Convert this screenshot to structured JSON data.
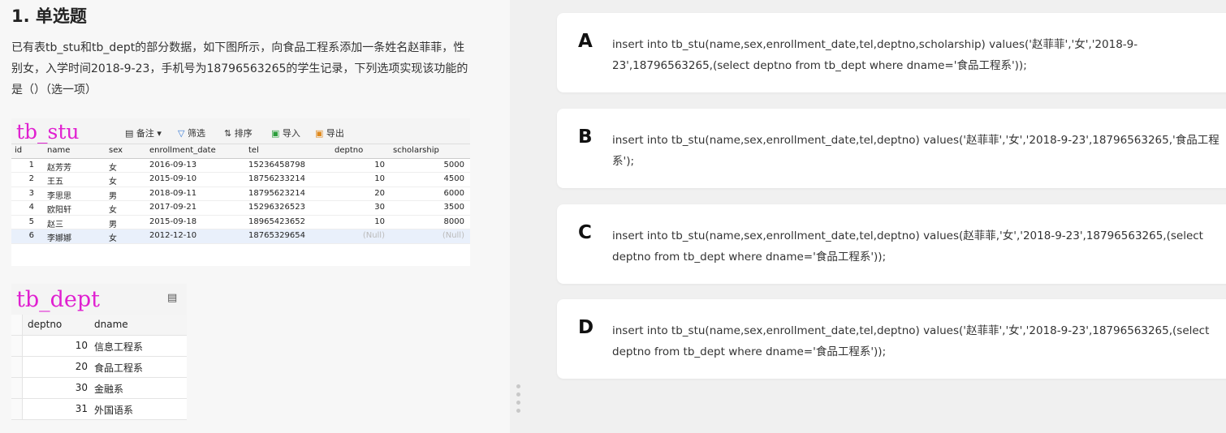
{
  "question": {
    "number_title": "1. 单选题",
    "text": "已有表tb_stu和tb_dept的部分数据，如下图所示，向食品工程系添加一条姓名赵菲菲，性别女，入学时间2018-9-23，手机号为18796563265的学生记录，下列选项实现该功能的是（）（选一项）"
  },
  "tb_stu": {
    "name": "tb_stu",
    "toolbar": {
      "note": "备注",
      "filter": "筛选",
      "sort": "排序",
      "import": "导入",
      "export": "导出"
    },
    "columns": [
      "id",
      "name",
      "sex",
      "enrollment_date",
      "tel",
      "deptno",
      "scholarship"
    ],
    "rows": [
      [
        "1",
        "赵芳芳",
        "女",
        "2016-09-13",
        "15236458798",
        "10",
        "5000"
      ],
      [
        "2",
        "王五",
        "女",
        "2015-09-10",
        "18756233214",
        "10",
        "4500"
      ],
      [
        "3",
        "李思思",
        "男",
        "2018-09-11",
        "18795623214",
        "20",
        "6000"
      ],
      [
        "4",
        "欧阳轩",
        "女",
        "2017-09-21",
        "15296326523",
        "30",
        "3500"
      ],
      [
        "5",
        "赵三",
        "男",
        "2015-09-18",
        "18965423652",
        "10",
        "8000"
      ],
      [
        "6",
        "李娜娜",
        "女",
        "2012-12-10",
        "18765329654",
        "(Null)",
        "(Null)"
      ]
    ]
  },
  "tb_dept": {
    "name": "tb_dept",
    "columns": [
      "deptno",
      "dname"
    ],
    "rows": [
      [
        "10",
        "信息工程系"
      ],
      [
        "20",
        "食品工程系"
      ],
      [
        "30",
        "金融系"
      ],
      [
        "31",
        "外国语系"
      ]
    ]
  },
  "options": [
    {
      "letter": "A",
      "text": "insert into tb_stu(name,sex,enrollment_date,tel,deptno,scholarship) values('赵菲菲','女','2018-9-23',18796563265,(select deptno from tb_dept where dname='食品工程系'));"
    },
    {
      "letter": "B",
      "text": "insert into tb_stu(name,sex,enrollment_date,tel,deptno) values('赵菲菲','女','2018-9-23',18796563265,'食品工程系');"
    },
    {
      "letter": "C",
      "text": "insert into tb_stu(name,sex,enrollment_date,tel,deptno) values(赵菲菲,'女','2018-9-23',18796563265,(select deptno from tb_dept where dname='食品工程系'));"
    },
    {
      "letter": "D",
      "text": "insert into tb_stu(name,sex,enrollment_date,tel,deptno) values('赵菲菲','女','2018-9-23',18796563265,(select deptno from tb_dept where dname='食品工程系'));"
    }
  ]
}
